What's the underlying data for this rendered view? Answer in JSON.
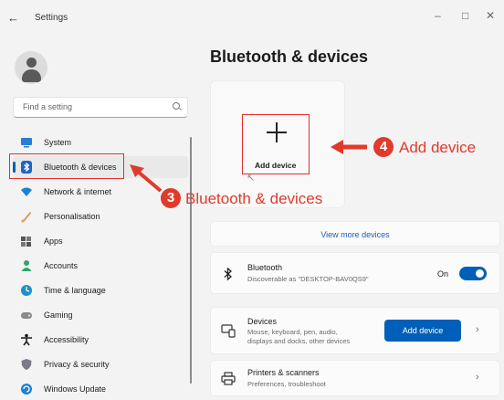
{
  "window": {
    "title": "Settings",
    "controls": {
      "minimize": "–",
      "maximize": "□",
      "close": "✕"
    }
  },
  "search": {
    "placeholder": "Find a setting"
  },
  "sidebar": {
    "items": [
      {
        "label": "System",
        "icon": "monitor-icon"
      },
      {
        "label": "Bluetooth & devices",
        "icon": "bluetooth-icon",
        "active": true
      },
      {
        "label": "Network & internet",
        "icon": "wifi-icon"
      },
      {
        "label": "Personalisation",
        "icon": "brush-icon"
      },
      {
        "label": "Apps",
        "icon": "apps-icon"
      },
      {
        "label": "Accounts",
        "icon": "person-icon"
      },
      {
        "label": "Time & language",
        "icon": "globe-clock-icon"
      },
      {
        "label": "Gaming",
        "icon": "gamepad-icon"
      },
      {
        "label": "Accessibility",
        "icon": "accessibility-icon"
      },
      {
        "label": "Privacy & security",
        "icon": "shield-icon"
      },
      {
        "label": "Windows Update",
        "icon": "update-icon"
      }
    ]
  },
  "main": {
    "title": "Bluetooth & devices",
    "add_device_tile": {
      "label": "Add device"
    },
    "view_more": "View more devices",
    "bluetooth": {
      "title": "Bluetooth",
      "subtitle": "Discoverable as \"DESKTOP-BAV0QS9\"",
      "state_label": "On",
      "on": true
    },
    "devices": {
      "title": "Devices",
      "subtitle_line1": "Mouse, keyboard, pen, audio,",
      "subtitle_line2": "displays and docks, other devices",
      "button": "Add device"
    },
    "printers": {
      "title": "Printers & scanners",
      "subtitle": "Preferences, troubleshoot"
    }
  },
  "annotations": {
    "step3": {
      "number": "3",
      "text": "Bluetooth & devices"
    },
    "step4": {
      "number": "4",
      "text": "Add device"
    },
    "accent_color": "#e03a2c"
  },
  "colors": {
    "accent": "#005fb8",
    "annotation": "#e03a2c"
  }
}
